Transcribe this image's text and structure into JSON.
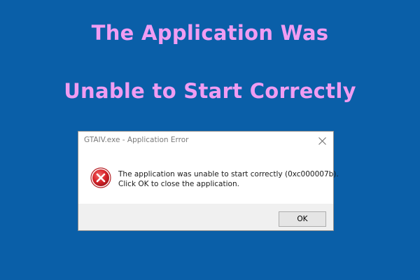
{
  "banner": {
    "line1": "The Application Was",
    "line2": "Unable to Start Correctly"
  },
  "dialog": {
    "title": "GTAIV.exe - Application Error",
    "message_line1": "The application was unable to start correctly (0xc000007b).",
    "message_line2": "Click OK to close the application.",
    "ok_label": "OK",
    "icon": "error-icon",
    "close_icon": "close-icon"
  },
  "colors": {
    "background": "#0a5fa8",
    "headline": "#f09cf2",
    "error_red": "#d9252c"
  }
}
